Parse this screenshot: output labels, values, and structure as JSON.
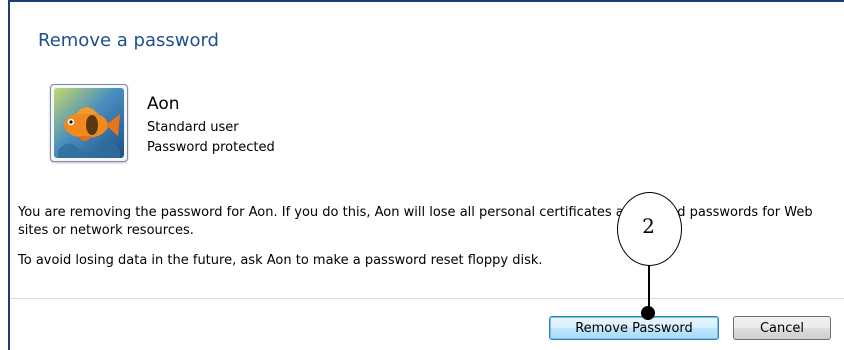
{
  "page": {
    "title": "Remove a password"
  },
  "user": {
    "name": "Aon",
    "type": "Standard user",
    "status": "Password protected",
    "avatar_icon": "fish-avatar-icon"
  },
  "message": {
    "line1": "You are removing the password for Aon.  If you do this, Aon will lose all personal certificates and stored passwords for Web sites or network resources.",
    "line2": "To avoid losing data in the future, ask Aon to make a password reset floppy disk."
  },
  "buttons": {
    "remove_label": "Remove Password",
    "cancel_label": "Cancel"
  },
  "annotation": {
    "number": "2"
  },
  "colors": {
    "title": "#1e4f8f",
    "frame": "#1c3f73",
    "primary_button_border": "#3c7fb1"
  }
}
